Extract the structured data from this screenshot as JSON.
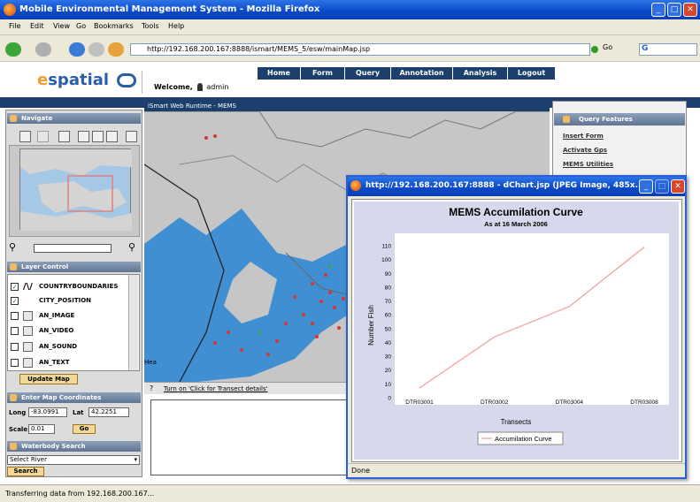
{
  "window": {
    "title": "Mobile Environmental Management System - Mozilla Firefox"
  },
  "menu": [
    "File",
    "Edit",
    "View",
    "Go",
    "Bookmarks",
    "Tools",
    "Help"
  ],
  "nav": {
    "url": "http://192.168.200.167:8888/ismart/MEMS_5/esw/mainMap.jsp",
    "go_label": "Go",
    "search_value": "G"
  },
  "header": {
    "logo_e": "e",
    "logo_text": "spatial",
    "welcome_label": "Welcome,",
    "user": "admin",
    "tabs": [
      "Home",
      "Form",
      "Query",
      "Annotation",
      "Analysis",
      "Logout"
    ]
  },
  "left": {
    "navigate_title": "Navigate",
    "layer_title": "Layer Control",
    "layers": [
      {
        "name": "COUNTRYBOUNDARIES",
        "checked": true
      },
      {
        "name": "CITY_POSITION",
        "checked": true
      },
      {
        "name": "AN_IMAGE",
        "checked": false
      },
      {
        "name": "AN_VIDEO",
        "checked": false
      },
      {
        "name": "AN_SOUND",
        "checked": false
      },
      {
        "name": "AN_TEXT",
        "checked": false
      }
    ],
    "update_label": "Update Map",
    "coords_title": "Enter Map Coordinates",
    "long_label": "Long",
    "long_value": "-83.0991",
    "lat_label": "Lat",
    "lat_value": "42.2251",
    "scale_label": "Scale",
    "scale_value": "0.01",
    "go_label": "Go",
    "waterbody_title": "Waterbody Search",
    "select_river": "Select River",
    "search_label": "Search"
  },
  "map": {
    "header": "iSmart Web Runtime - MEMS",
    "status_link": "Turn on 'Click for Transect details'",
    "city_label": "Hea"
  },
  "right": {
    "query_title": "Query Features",
    "links": [
      "Insert Form",
      "Activate Gps",
      "MEMS Utilities"
    ]
  },
  "popup": {
    "title": "http://192.168.200.167:8888 - dChart.jsp (JPEG Image, 485x...",
    "status": "Done"
  },
  "chart_data": {
    "type": "line",
    "title": "MEMS Accumilation Curve",
    "subtitle": "As at 16 March 2006",
    "xlabel": "Transects",
    "ylabel": "Number Fish",
    "categories": [
      "DTR03001",
      "DTR03002",
      "DTR03004",
      "DTR03008"
    ],
    "series": [
      {
        "name": "Accumilation Curve",
        "values": [
          7,
          44,
          66,
          109
        ],
        "color": "#f2a3a3"
      }
    ],
    "ylim": [
      0,
      110
    ],
    "yticks": [
      0,
      10,
      20,
      30,
      40,
      50,
      60,
      70,
      80,
      90,
      100,
      110
    ],
    "legend": "bottom",
    "grid": false
  },
  "statusbar": {
    "text": "Transferring data from 192.168.200.167..."
  },
  "colors": {
    "navy": "#1c3f6e",
    "xp_blue": "#0a48c9",
    "water": "#3f8fd2",
    "land": "#c6c6c6",
    "point": "#e0322e"
  }
}
